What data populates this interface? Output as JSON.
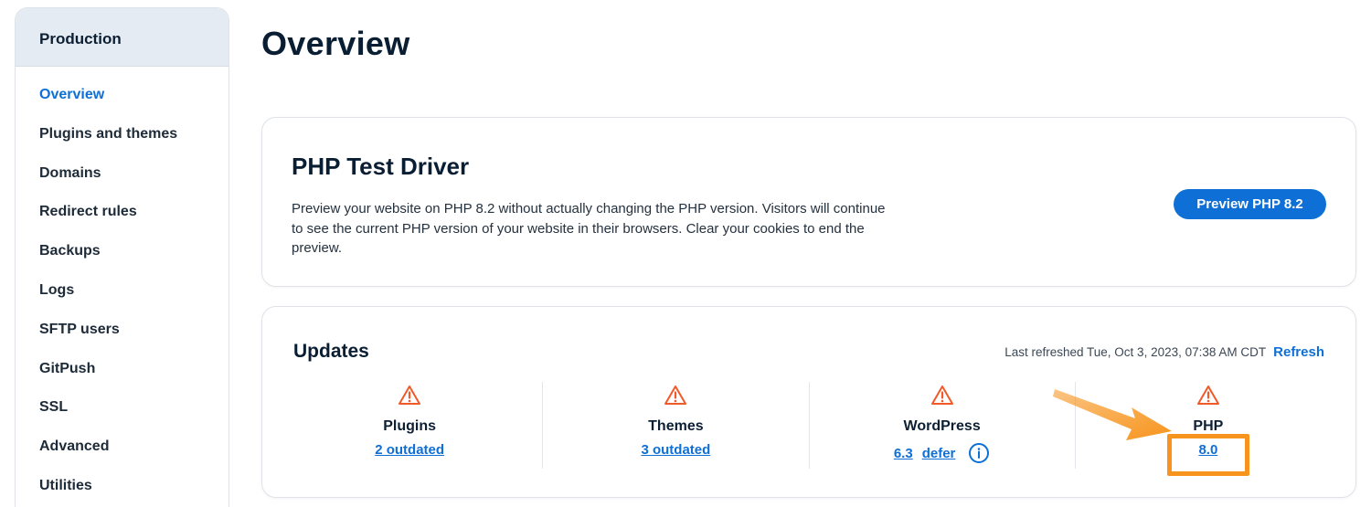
{
  "sidebar": {
    "header": "Production",
    "items": [
      {
        "label": "Overview",
        "active": true
      },
      {
        "label": "Plugins and themes"
      },
      {
        "label": "Domains"
      },
      {
        "label": "Redirect rules"
      },
      {
        "label": "Backups"
      },
      {
        "label": "Logs"
      },
      {
        "label": "SFTP users"
      },
      {
        "label": "GitPush"
      },
      {
        "label": "SSL"
      },
      {
        "label": "Advanced"
      },
      {
        "label": "Utilities"
      }
    ]
  },
  "page": {
    "title": "Overview"
  },
  "php_test_driver": {
    "title": "PHP Test Driver",
    "description": "Preview your website on PHP 8.2 without actually changing the PHP version. Visitors will continue to see the current PHP version of your website in their browsers. Clear your cookies to end the preview.",
    "button_label": "Preview PHP 8.2"
  },
  "updates": {
    "title": "Updates",
    "last_refreshed": "Last refreshed Tue, Oct 3, 2023, 07:38 AM CDT",
    "refresh_label": "Refresh",
    "columns": [
      {
        "label": "Plugins",
        "link": "2 outdated"
      },
      {
        "label": "Themes",
        "link": "3 outdated"
      },
      {
        "label": "WordPress",
        "link": "6.3",
        "link2": "defer"
      },
      {
        "label": "PHP",
        "link": "8.0"
      }
    ]
  },
  "colors": {
    "accent": "#0e6fd6",
    "warning": "#f05a28",
    "highlight": "#f7941d"
  },
  "icons": [
    "warning-triangle-icon",
    "info-circle-icon",
    "arrow-annotation"
  ]
}
